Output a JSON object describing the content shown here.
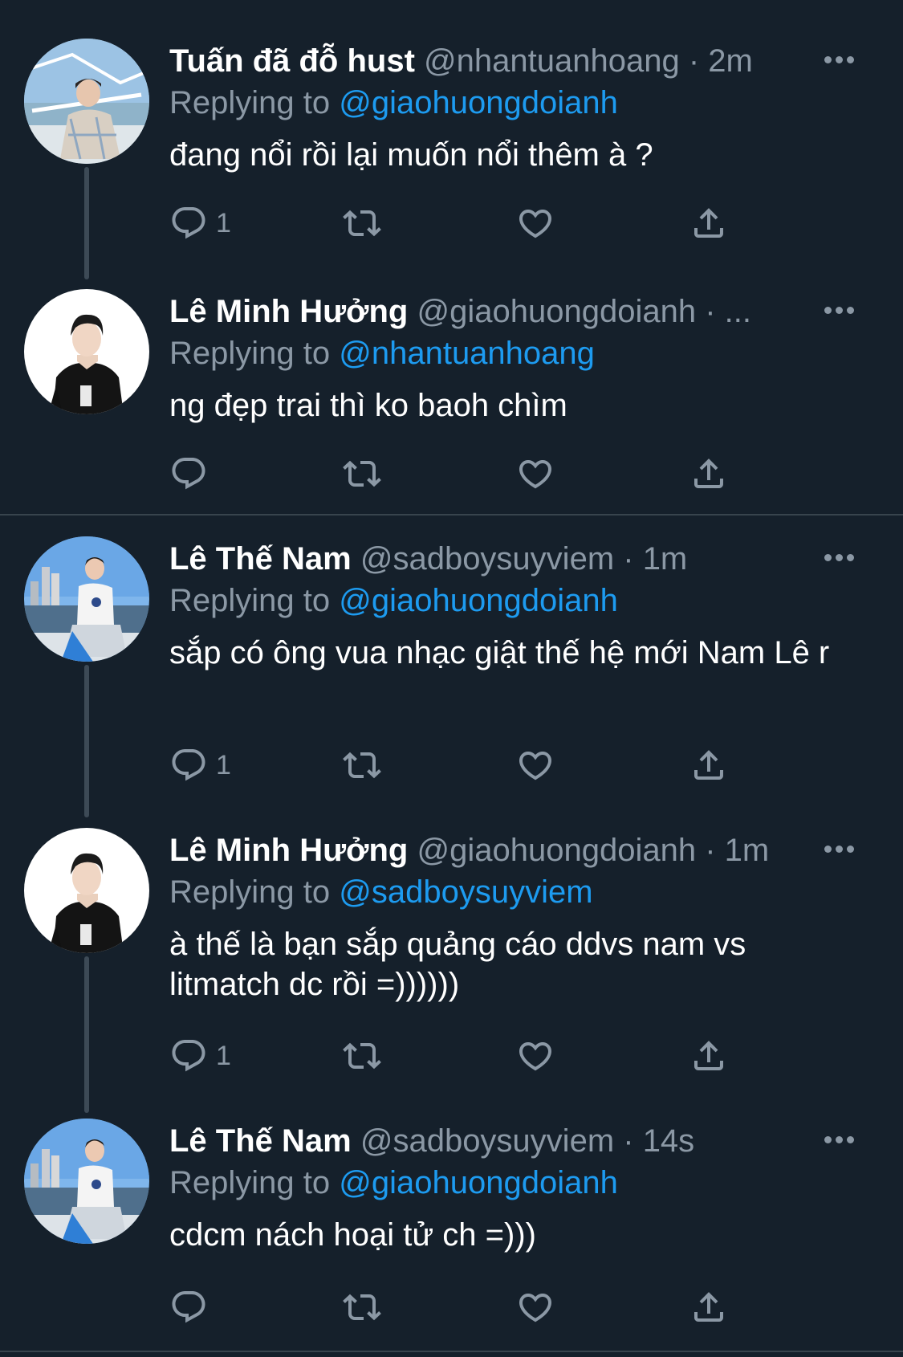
{
  "tweets": [
    {
      "name": "Tuấn đã đỗ hust",
      "handle": "@nhantuanhoang",
      "dot": " · ",
      "time": "2m",
      "replying_label": "Replying to ",
      "replying_to": "@giaohuongdoianh",
      "text": "đang nổi rồi lại muốn nổi thêm à ?",
      "reply_count": "1"
    },
    {
      "name": "Lê Minh Hưởng",
      "handle": "@giaohuongdoianh",
      "dot": " · ...",
      "time": "",
      "replying_label": "Replying to ",
      "replying_to": "@nhantuanhoang",
      "text": "ng đẹp trai thì ko baoh chìm",
      "reply_count": ""
    },
    {
      "name": "Lê Thế Nam",
      "handle": "@sadboysuyviem",
      "dot": " · ",
      "time": "1m",
      "replying_label": "Replying to ",
      "replying_to": "@giaohuongdoianh",
      "text": "sắp có ông vua nhạc giật thế hệ mới Nam Lê r",
      "reply_count": "1"
    },
    {
      "name": "Lê Minh Hưởng",
      "handle": "@giaohuongdoianh",
      "dot": " · ",
      "time": "1m",
      "replying_label": "Replying to ",
      "replying_to": "@sadboysuyviem",
      "text": "à thế là bạn sắp quảng cáo ddvs nam vs litmatch dc rồi =))))))",
      "reply_count": "1"
    },
    {
      "name": "Lê Thế Nam",
      "handle": "@sadboysuyviem",
      "dot": " · ",
      "time": "14s",
      "replying_label": "Replying to ",
      "replying_to": "@giaohuongdoianh",
      "text": "cdcm nách hoại tử ch =)))",
      "reply_count": ""
    }
  ],
  "icons": [
    "reply-icon",
    "retweet-icon",
    "like-icon",
    "share-icon",
    "more-icon"
  ],
  "colors": {
    "background": "#15202b",
    "accent": "#1d9bf0",
    "muted": "#8b98a5",
    "separator": "#38444d"
  }
}
